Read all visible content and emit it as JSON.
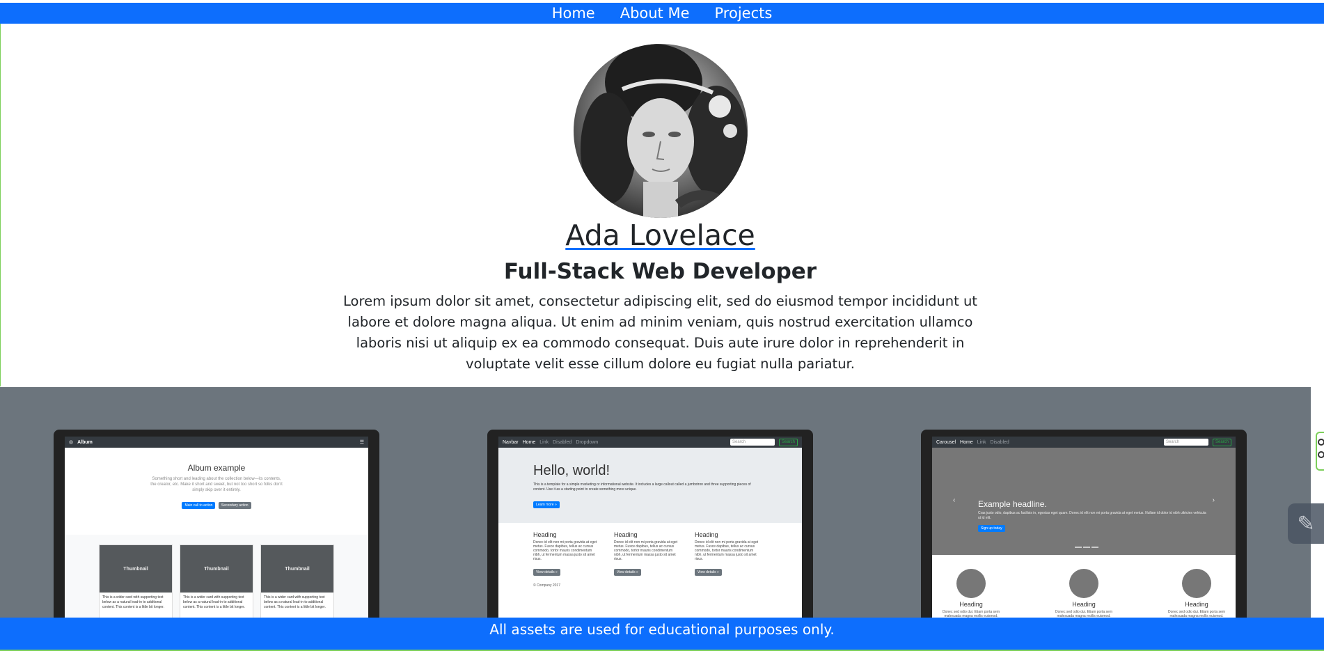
{
  "nav": {
    "items": [
      {
        "label": "Home"
      },
      {
        "label": "About Me"
      },
      {
        "label": "Projects"
      }
    ]
  },
  "hero": {
    "name": "Ada Lovelace",
    "title": "Full-Stack Web Developer",
    "bio": "Lorem ipsum dolor sit amet, consectetur adipiscing elit, sed do eiusmod tempor incididunt ut labore et dolore magna aliqua. Ut enim ad minim veniam, quis nostrud exercitation ullamco laboris nisi ut aliquip ex ea commodo consequat. Duis aute irure dolor in reprehenderit in voluptate velit esse cillum dolore eu fugiat nulla pariatur."
  },
  "projects": {
    "album": {
      "brand": "Album",
      "title": "Album example",
      "lead": "Something short and leading about the collection below—its contents, the creator, etc. Make it short and sweet, but not too short so folks don't simply skip over it entirely.",
      "primary_btn": "Main call to action",
      "secondary_btn": "Secondary action",
      "thumb": "Thumbnail",
      "card_text": "This is a wider card with supporting text below as a natural lead-in to additional content. This content is a little bit longer."
    },
    "jumbotron": {
      "brand": "Navbar",
      "nav_home": "Home",
      "nav_link": "Link",
      "nav_disabled": "Disabled",
      "nav_dropdown": "Dropdown",
      "search": "Search",
      "title": "Hello, world!",
      "lead": "This is a template for a simple marketing or informational website. It includes a large callout called a jumbotron and three supporting pieces of content. Use it as a starting point to create something more unique.",
      "btn": "Learn more »",
      "col_heading": "Heading",
      "col_text": "Donec id elit non mi porta gravida at eget metus. Fusce dapibus, tellus ac cursus commodo, tortor mauris condimentum nibh, ut fermentum massa justo sit amet risus.",
      "col_btn": "View details »",
      "footer": "© Company 2017"
    },
    "carousel": {
      "brand": "Carousel",
      "nav_home": "Home",
      "nav_link": "Link",
      "nav_disabled": "Disabled",
      "search": "Search",
      "headline": "Example headline.",
      "lead": "Cras justo odio, dapibus ac facilisis in, egestas eget quam. Donec id elit non mi porta gravida at eget metus. Nullam id dolor id nibh ultricies vehicula ut id elit.",
      "btn": "Sign up today",
      "heading": "Heading",
      "text": "Donec sed odio dui. Etiam porta sem malesuada magna mollis euismod. Nullam id dolor id nibh ultricies vehicula ut id elit."
    }
  },
  "footer": {
    "text": "All assets are used for educational purposes only."
  },
  "colors": {
    "primary": "#0d6efd",
    "band": "#6c757d"
  }
}
